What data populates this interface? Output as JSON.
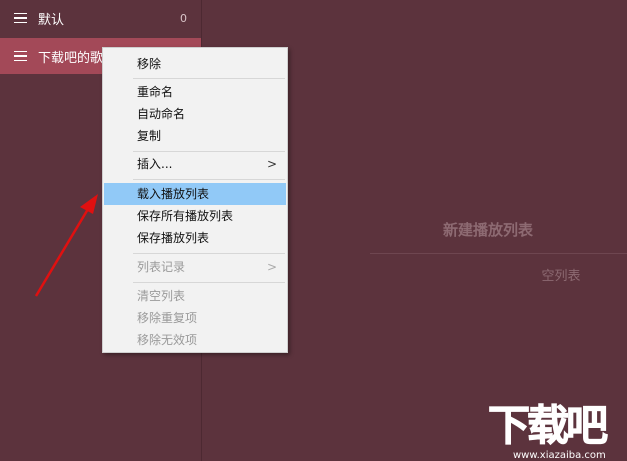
{
  "playlists": [
    {
      "name": "默认",
      "count": "0"
    },
    {
      "name": "下载吧的歌",
      "count": ""
    }
  ],
  "main": {
    "new_playlist": "新建播放列表",
    "empty_label": "空列表"
  },
  "context_menu": {
    "items": [
      {
        "label": "移除",
        "disabled": false
      },
      {
        "label": "重命名",
        "disabled": false
      },
      {
        "label": "自动命名",
        "disabled": false
      },
      {
        "label": "复制",
        "disabled": false
      },
      {
        "label": "插入...",
        "disabled": false,
        "submenu": true
      },
      {
        "label": "载入播放列表",
        "disabled": false,
        "highlighted": true
      },
      {
        "label": "保存所有播放列表",
        "disabled": false
      },
      {
        "label": "保存播放列表",
        "disabled": false
      },
      {
        "label": "列表记录",
        "disabled": true,
        "submenu": true
      },
      {
        "label": "清空列表",
        "disabled": true
      },
      {
        "label": "移除重复项",
        "disabled": true
      },
      {
        "label": "移除无效项",
        "disabled": true
      }
    ],
    "submenu_arrow": ">"
  },
  "watermark": {
    "big": "下载吧",
    "small": "www.xiazaiba.com"
  },
  "colors": {
    "background": "#5c333d",
    "selected_item": "#a34958",
    "menu_highlight": "#91c9f7",
    "annotation_arrow": "#e01010"
  }
}
